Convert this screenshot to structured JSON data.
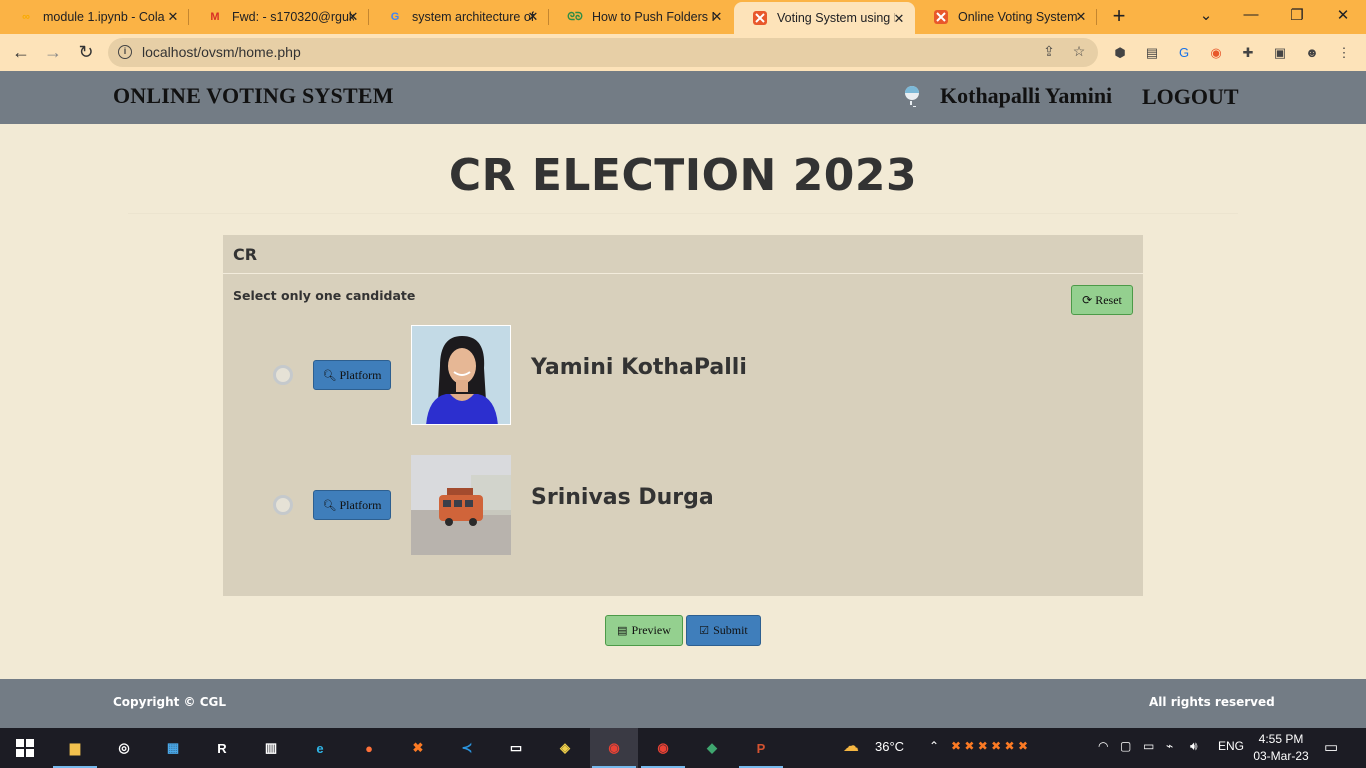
{
  "browser": {
    "tabs": [
      {
        "title": "module 1.ipynb - Cola",
        "icon": "colab-icon",
        "color": "#f9ab00"
      },
      {
        "title": "Fwd: - s170320@rguk",
        "icon": "gmail-icon",
        "color": "#d93025"
      },
      {
        "title": "system architecture of",
        "icon": "google-icon",
        "color": "#4285f4"
      },
      {
        "title": "How to Push Folders F",
        "icon": "geeksforgeeks-icon",
        "color": "#2f8d46"
      },
      {
        "title": "Voting System using P",
        "icon": "xampp-icon",
        "color": "#e8582b",
        "active": true
      },
      {
        "title": "Online Voting System",
        "icon": "xampp-icon",
        "color": "#e8582b"
      }
    ],
    "new_tab": "+",
    "url": "localhost/ovsm/home.php"
  },
  "site": {
    "brand": "ONLINE VOTING SYSTEM",
    "user_name": "Kothapalli Yamini",
    "logout": "LOGOUT"
  },
  "election": {
    "title": "CR ELECTION 2023",
    "position": "CR",
    "instruction": "Select only one candidate",
    "reset_label": "Reset",
    "candidates": [
      {
        "name": "Yamini KothaPalli",
        "platform_label": "Platform"
      },
      {
        "name": "Srinivas Durga",
        "platform_label": "Platform"
      }
    ],
    "preview_label": "Preview",
    "submit_label": "Submit"
  },
  "footer": {
    "copyright": "Copyright © CGL",
    "rights": "All rights reserved"
  },
  "taskbar": {
    "weather": "36°C",
    "language": "ENG",
    "time": "4:55 PM",
    "date": "03-Mar-23"
  },
  "colors": {
    "nav_bg": "#737c85",
    "page_bg": "#f2ead5",
    "box_bg": "#d8d0bc",
    "btn_green": "#94d08f",
    "btn_blue": "#3f7ebb"
  }
}
